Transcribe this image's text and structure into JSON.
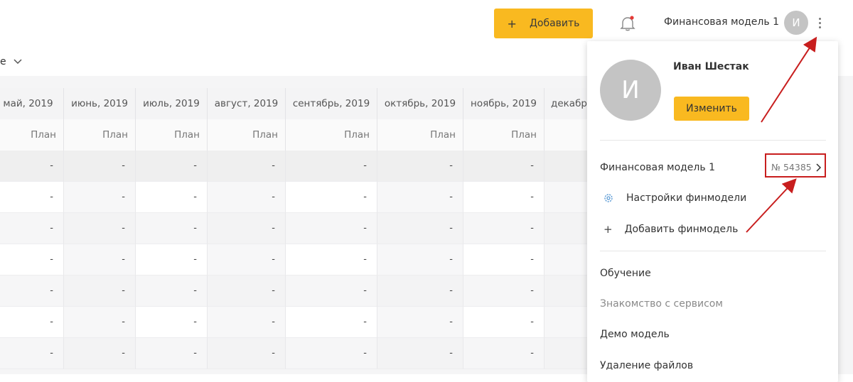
{
  "header": {
    "add_label": "Добавить",
    "add_icon": "+",
    "model_name": "Финансовая модель 1",
    "avatar_letter": "И"
  },
  "subheader": {
    "view_label": "е"
  },
  "table": {
    "columns": [
      "май, 2019",
      "июнь, 2019",
      "июль, 2019",
      "август, 2019",
      "сентябрь, 2019",
      "октябрь, 2019",
      "ноябрь, 2019",
      "декабр"
    ],
    "sub_label": "План",
    "empty_value": "-"
  },
  "panel": {
    "avatar_letter": "И",
    "user_name": "Иван Шестак",
    "edit_label": "Изменить",
    "model_name": "Финансовая модель 1",
    "model_number": "№ 54385",
    "settings_label": "Настройки финмодели",
    "add_model_label": "Добавить финмодель",
    "menu": {
      "learning": "Обучение",
      "intro": "Знакомство с сервисом",
      "demo": "Демо модель",
      "delete_files": "Удаление файлов"
    }
  },
  "colors": {
    "accent": "#f9b920",
    "annotation": "#c81e1e",
    "avatar": "#c4c4c4"
  }
}
